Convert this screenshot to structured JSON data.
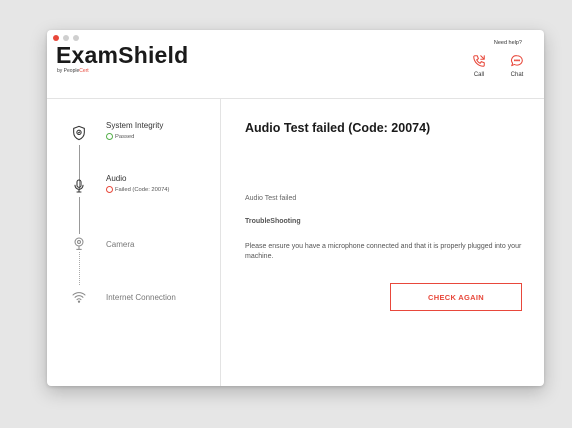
{
  "app": {
    "brand": "ExamShield",
    "sub_prefix": "by People",
    "sub_accent": "Cert"
  },
  "help": {
    "label": "Need help?",
    "call_label": "Call",
    "chat_label": "Chat",
    "call_icon": "phone-icon",
    "chat_icon": "chat-bubble-icon"
  },
  "steps": [
    {
      "title": "System Integrity",
      "status": "Passed",
      "state": "passed",
      "icon": "shield-icon"
    },
    {
      "title": "Audio",
      "status": "Failed (Code: 20074)",
      "state": "failed",
      "icon": "microphone-icon"
    },
    {
      "title": "Camera",
      "status": "",
      "state": "pending",
      "icon": "webcam-icon"
    },
    {
      "title": "Internet Connection",
      "status": "",
      "state": "pending",
      "icon": "wifi-icon"
    }
  ],
  "main": {
    "title": "Audio Test failed (Code: 20074)",
    "subtitle": "Audio Test failed",
    "section_head": "TroubleShooting",
    "body": "Please ensure you have a microphone connected and that it is properly plugged into your machine.",
    "button_label": "CHECK AGAIN"
  },
  "colors": {
    "accent": "#e8483b",
    "passed": "#55b04a"
  }
}
